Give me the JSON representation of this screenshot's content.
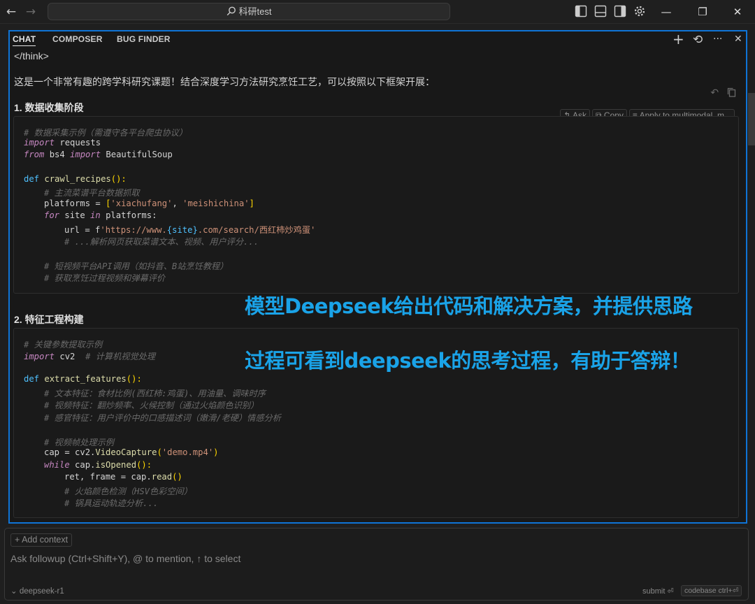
{
  "titlebar": {
    "search_text": "科研test",
    "back_icon": "←",
    "forward_icon": "→",
    "minimize": "—",
    "restore": "❐",
    "close": "✕"
  },
  "tabs": {
    "chat": "CHAT",
    "composer": "COMPOSER",
    "bug_finder": "BUG FINDER"
  },
  "panel_icons": {
    "new": "+",
    "history": "⟲",
    "more": "···",
    "close": "✕"
  },
  "message": {
    "think_tag": "</think>",
    "intro": "这是一个非常有趣的跨学科研究课题！结合深度学习方法研究烹饪工艺，可以按照以下框架开展：",
    "section1": "1. 数据收集阶段",
    "section2": "2. 特征工程构建"
  },
  "code_actions": {
    "ask": "Ask",
    "copy": "Copy",
    "apply": "Apply to multimodal_m..."
  },
  "code1": {
    "l1": "# 数据采集示例（需遵守各平台爬虫协议）",
    "l2_kw": "import",
    "l2_rest": " requests",
    "l3_kw1": "from",
    "l3_mid": " bs4 ",
    "l3_kw2": "import",
    "l3_rest": " BeautifulSoup",
    "l5_kw": "def",
    "l5_fn": "crawl_recipes",
    "l5_rest": "():",
    "l6": "# 主流菜谱平台数据抓取",
    "l7_var": "platforms = ",
    "l7_s1": "'xiachufang'",
    "l7_sep": ", ",
    "l7_s2": "'meishichina'",
    "l8_kw1": "for",
    "l8_mid": " site ",
    "l8_kw2": "in",
    "l8_rest": " platforms:",
    "l9_var": "url = f",
    "l9_s1": "'https://www.",
    "l9_var2": "{site}",
    "l9_s2": ".com/search/西红柿炒鸡蛋'",
    "l10": "# ...解析网页获取菜谱文本、视频、用户评分...",
    "l12": "# 短视频平台API调用（如抖音、B站烹饪教程）",
    "l13": "# 获取烹饪过程视频和弹幕评价"
  },
  "code2": {
    "l1": "# 关键参数提取示例",
    "l2_kw": "import",
    "l2_rest": " cv2  ",
    "l2_com": "# 计算机视觉处理",
    "l4_kw": "def",
    "l4_fn": "extract_features",
    "l4_rest": "():",
    "l5": "# 文本特征：食材比例(西红柿:鸡蛋)、用油量、调味时序",
    "l6": "# 视频特征：翻炒频率、火候控制（通过火焰颜色识别）",
    "l7": "# 感官特征：用户评价中的口感描述词（嫩滑/老硬）情感分析",
    "l9": "# 视频帧处理示例",
    "l10_var": "cap = cv2.",
    "l10_fn": "VideoCapture",
    "l10_str": "'demo.mp4'",
    "l11_kw": "while",
    "l11_var": " cap.",
    "l11_fn": "isOpened",
    "l11_rest": "():",
    "l12_var": "ret, frame = cap.",
    "l12_fn": "read",
    "l13": "# 火焰颜色检测（HSV色彩空间）",
    "l14": "# 锅具运动轨迹分析..."
  },
  "overlay": {
    "line1": "模型Deepseek给出代码和解决方案，并提供思路",
    "line2": "过程可看到deepseek的思考过程，有助于答辩！"
  },
  "composer": {
    "add_context": "+ Add context",
    "placeholder": "Ask followup (Ctrl+Shift+Y), @ to mention, ↑ to select",
    "model": "deepseek-r1",
    "submit": "submit",
    "codebase": "codebase",
    "codebase_shortcut": "ctrl+⏎"
  },
  "colors": {
    "accent_border": "#0f74d6",
    "overlay_text": "#1aa3e8"
  }
}
